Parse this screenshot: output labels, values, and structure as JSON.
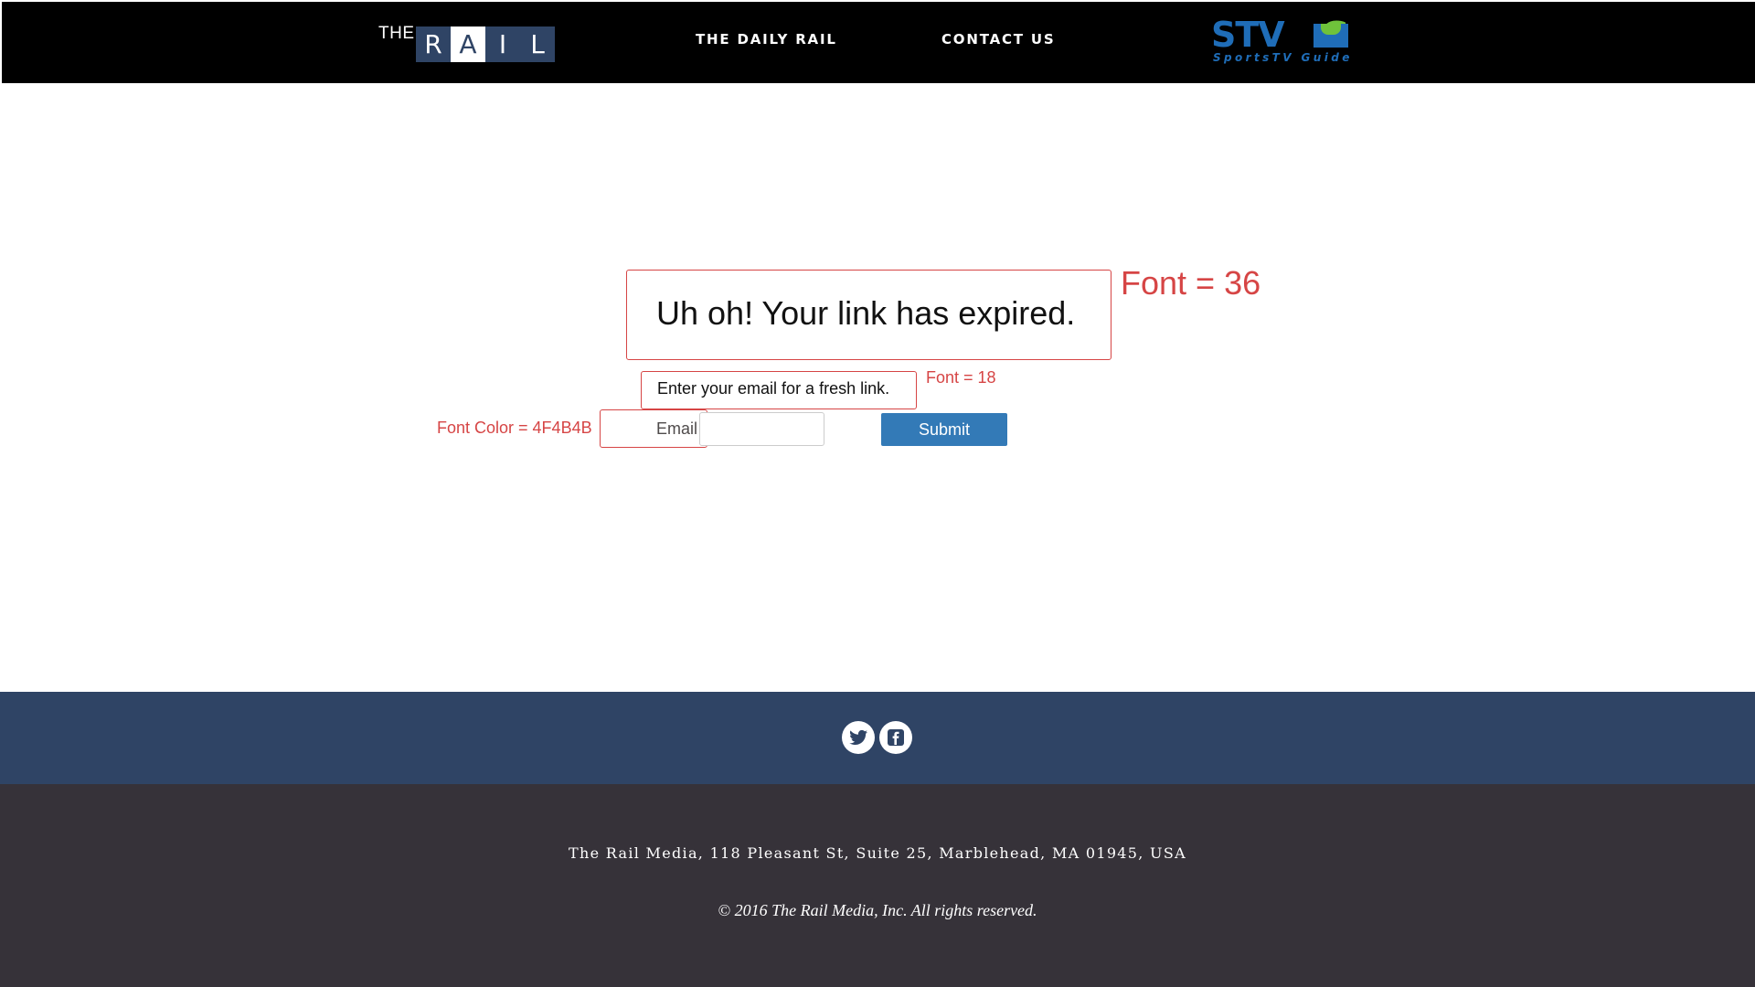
{
  "header": {
    "logo": {
      "prefix": "THE",
      "letters": [
        "R",
        "A",
        "I",
        "L"
      ]
    },
    "nav": {
      "daily_rail": "THE DAILY RAIL",
      "contact_us": "CONTACT US"
    },
    "partner_logo": {
      "big_left": "STV",
      "big_right": "G",
      "tagline": "SportsTV Guide"
    }
  },
  "main": {
    "title": "Uh oh! Your link has expired.",
    "subtitle": "Enter your email for a fresh link.",
    "email_label": "Email",
    "email_value": "",
    "submit_label": "Submit"
  },
  "annotations": {
    "title_font": "Font = 36",
    "subtitle_font": "Font = 18",
    "label_color": "Font Color = 4F4B4B"
  },
  "footer": {
    "social": [
      "twitter-icon",
      "facebook-icon"
    ],
    "address": "The Rail Media, 118 Pleasant St, Suite 25, Marblehead, MA 01945, USA",
    "copyright": "© 2016 The Rail Media, Inc. All rights reserved."
  },
  "colors": {
    "header_bg": "#000000",
    "logo_blue": "#2f4465",
    "annotation_red": "#d64545",
    "label_color": "#4f4b4b",
    "button_blue": "#337ab7",
    "social_bar_bg": "#2f4465",
    "footer_bg": "#363239",
    "stvg_blue": "#1f6db8",
    "stvg_green": "#6fc23b"
  }
}
